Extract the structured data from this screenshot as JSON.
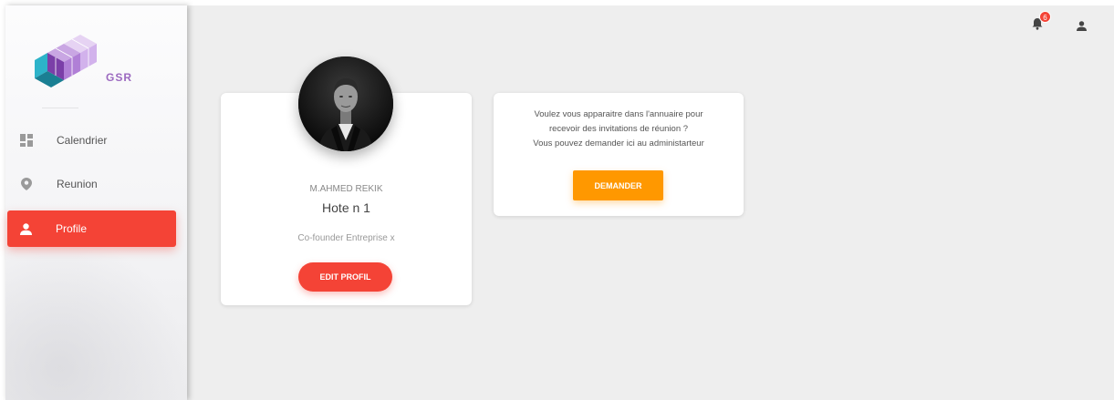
{
  "brand": {
    "name": "GSR"
  },
  "sidebar": {
    "items": [
      {
        "label": "Calendrier",
        "icon": "dashboard-icon",
        "active": false
      },
      {
        "label": "Reunion",
        "icon": "location-pin-icon",
        "active": false
      },
      {
        "label": "Profile",
        "icon": "person-icon",
        "active": true
      }
    ]
  },
  "topbar": {
    "notifications_count": "6",
    "icons": [
      "bell-icon",
      "person-icon"
    ]
  },
  "profile": {
    "category": "M.AHMED REKIK",
    "title": "Hote n 1",
    "description": "Co-founder Entreprise x",
    "button_label": "EDIT PROFIL"
  },
  "request": {
    "lines": [
      "Voulez vous apparaitre dans l'annuaire pour",
      "recevoir des invitations de réunion ?",
      "Vous pouvez demander ici au administarteur"
    ],
    "button_label": "DEMANDER"
  },
  "colors": {
    "active": "#f44336",
    "warning": "#ff9800",
    "background": "#eeeeee",
    "logo_purple": "#9c6ac0"
  }
}
